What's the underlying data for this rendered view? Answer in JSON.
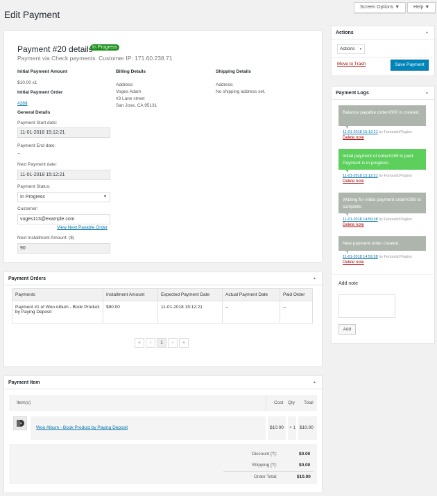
{
  "page": {
    "title": "Edit Payment",
    "screen_options": "Screen Options ▼",
    "help": "Help ▼"
  },
  "details": {
    "heading": "Payment #20 details",
    "badge": "In Progress",
    "subtitle": "Payment via Check payments. Customer IP: 171.60.238.71",
    "initial_amount_label": "Initial Payment Amount",
    "initial_amount_value": "$10.00 x1",
    "initial_order_label": "Initial Payment Order",
    "initial_order_link": "#289",
    "general_label": "General Details",
    "start_date_label": "Payment Start date:",
    "start_date_value": "11-01-2018 15:12:21",
    "end_date_label": "Payment End date:",
    "end_date_value": "--",
    "next_date_label": "Next Payment date:",
    "next_date_value": "11-01-2018 15:12:21",
    "status_label": "Payment Status:",
    "status_value": "In Progress",
    "customer_label": "Customer:",
    "customer_value": "voges113@example.com",
    "view_next_link": "View Next Payable Order",
    "installment_label": "Next Installment Amount: ($)",
    "installment_value": "90",
    "billing_label": "Billing Details",
    "billing_addr_label": "Address:",
    "billing_line1": "Voges Adam",
    "billing_line2": "#3 Lane street",
    "billing_line3": "San Jose, CA 95131",
    "shipping_label": "Shipping Details",
    "shipping_addr_label": "Address:",
    "shipping_value": "No shipping address set."
  },
  "orders": {
    "title": "Payment Orders",
    "headers": [
      "Payments",
      "Installment Amount",
      "Expected Payment Date",
      "Actual Payment Date",
      "Paid Order"
    ],
    "row": [
      "Payment #1 of Woo Album - Book Product by Paying Deposit",
      "$90.00",
      "11-01-2018 15:12:21",
      "--",
      "--"
    ],
    "pagination": [
      "«",
      "‹",
      "1",
      "›",
      "»"
    ]
  },
  "item": {
    "title": "Payment Item",
    "col_items": "Item(s)",
    "col_cost": "Cost",
    "col_qty": "Qty",
    "col_total": "Total",
    "product": "Woo Album - Book Product by Paying Deposit",
    "cost": "$10.00",
    "qty": "× 1",
    "total": "$10.00",
    "discount_label": "Discount [?]:",
    "discount_value": "$0.00",
    "shipping_label": "Shipping [?]:",
    "shipping_value": "$0.00",
    "order_total_label": "Order Total:",
    "order_total_value": "$10.00"
  },
  "actions": {
    "title": "Actions",
    "select": "Actions",
    "trash": "Move to Trash",
    "save": "Save Payment"
  },
  "logs": {
    "title": "Payment Logs",
    "notes": [
      {
        "text": "Balance payable order#300 is created.",
        "date": "11-01-2018 15:12:21",
        "by": " by FantasticPlugins",
        "delete": "Delete note"
      },
      {
        "text": "Initial payment of order#289 is paid. Payment is in progress",
        "date": "11-01-2018 15:12:21",
        "by": " by FantasticPlugins",
        "delete": "Delete note"
      },
      {
        "text": "Waiting for initial payment order#289 to complete.",
        "date": "11-01-2018 14:59:38",
        "by": " by FantasticPlugins",
        "delete": "Delete note"
      },
      {
        "text": "New payment order created.",
        "date": "11-01-2018 14:59:38",
        "by": " by FantasticPlugins",
        "delete": "Delete note"
      }
    ],
    "add_note_label": "Add note",
    "add_button": "Add"
  },
  "colors": {
    "badge": "#1a8f1a",
    "note_grey": "#adb5ad",
    "note_green": "#5ccf5c",
    "button_blue": "#0085ba"
  }
}
